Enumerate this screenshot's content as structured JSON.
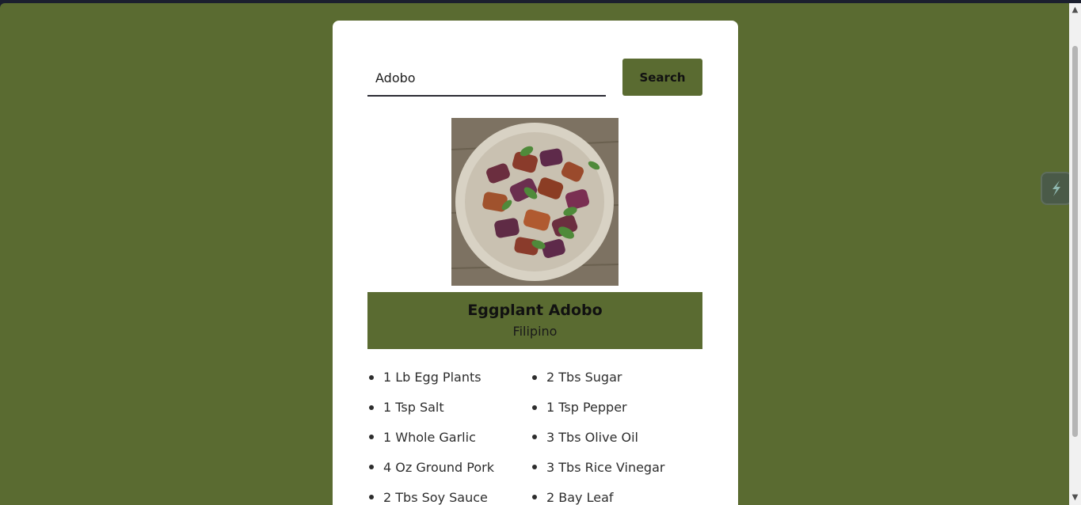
{
  "search": {
    "value": "Adobo",
    "button_label": "Search"
  },
  "recipe": {
    "title": "Eggplant Adobo",
    "cuisine": "Filipino",
    "image_icon": "food-photo",
    "ingredients": [
      "1 Lb Egg Plants",
      "2 Tbs Sugar",
      "1 Tsp Salt",
      "1 Tsp Pepper",
      "1 Whole Garlic",
      "3 Tbs Olive Oil",
      "4 Oz Ground Pork",
      "3 Tbs Rice Vinegar",
      "2 Tbs Soy Sauce",
      "2 Bay Leaf"
    ]
  },
  "colors": {
    "background": "#5a6b31",
    "accent": "#5a6b31",
    "card": "#ffffff"
  },
  "scrollbar": {
    "up_icon": "▲",
    "down_icon": "▼"
  }
}
